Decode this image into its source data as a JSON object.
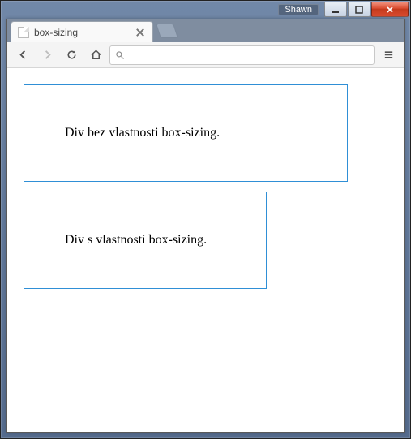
{
  "window": {
    "user": "Shawn"
  },
  "browser": {
    "tab_title": "box-sizing",
    "address_value": ""
  },
  "content": {
    "box1_text": "Div bez vlastnosti box-sizing.",
    "box2_text": "Div s vlastností box-sizing."
  },
  "colors": {
    "box_border": "#2f8fd6"
  }
}
